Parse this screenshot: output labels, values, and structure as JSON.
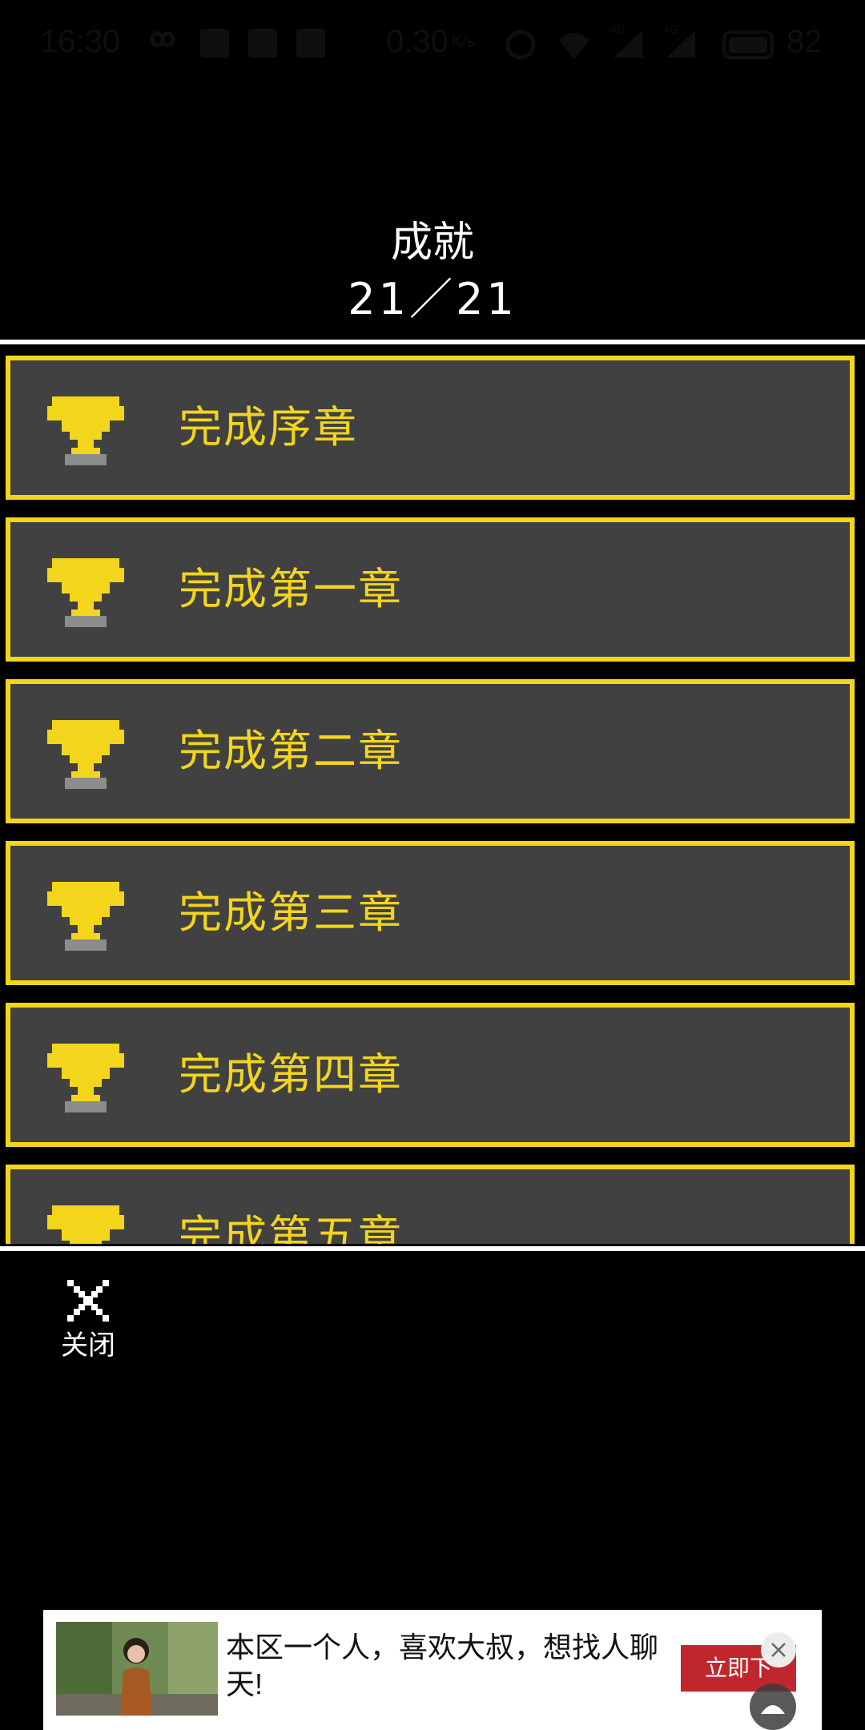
{
  "status_bar": {
    "time": "16:30",
    "net_speed": "0.30",
    "net_speed_unit": "K/s",
    "network_label_1": "4G",
    "network_label_2": "4G",
    "battery": "82",
    "icons": [
      "infinity-icon",
      "qq-icon",
      "weibo-icon",
      "mail-icon",
      "alarm-icon",
      "wifi-icon",
      "signal-icon",
      "signal-icon",
      "battery-icon"
    ]
  },
  "header": {
    "title": "成就",
    "count": "21／21"
  },
  "achievements": [
    {
      "label": "完成序章",
      "icon": "trophy-icon"
    },
    {
      "label": "完成第一章",
      "icon": "trophy-icon"
    },
    {
      "label": "完成第二章",
      "icon": "trophy-icon"
    },
    {
      "label": "完成第三章",
      "icon": "trophy-icon"
    },
    {
      "label": "完成第四章",
      "icon": "trophy-icon"
    },
    {
      "label": "完成第五章",
      "icon": "trophy-icon"
    }
  ],
  "close": {
    "label": "关闭",
    "icon": "close-x-icon"
  },
  "ad": {
    "text": "本区一个人，喜欢大叔，想找人聊天!",
    "cta": "立即下",
    "close_icon": "close-icon"
  },
  "colors": {
    "accent": "#f3d51c",
    "item_bg": "#414141",
    "background": "#000000",
    "ad_button": "#c0272d"
  }
}
